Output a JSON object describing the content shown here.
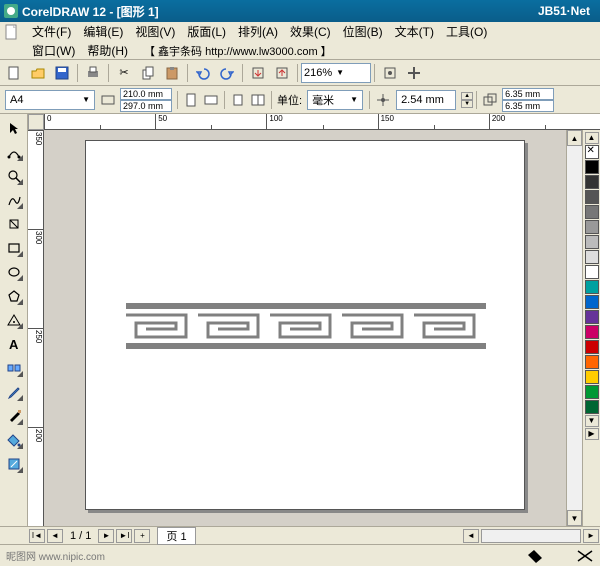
{
  "title": "CorelDRAW 12 - [图形 1]",
  "brand": "JB51·Net",
  "menus": {
    "file": "文件(F)",
    "edit": "编辑(E)",
    "view": "视图(V)",
    "layout": "版面(L)",
    "arrange": "排列(A)",
    "effects": "效果(C)",
    "bitmaps": "位图(B)",
    "text": "文本(T)",
    "tools": "工具(O)",
    "window": "窗口(W)",
    "help": "帮助(H)"
  },
  "menu_extra": "【 鑫宇条码 http://www.lw3000.com 】",
  "zoom": "216%",
  "propbar": {
    "paper": "A4",
    "width": "210.0 mm",
    "height": "297.0 mm",
    "units_label": "单位:",
    "units_value": "毫米",
    "nudge": "2.54 mm",
    "dup_x": "6.35 mm",
    "dup_y": "6.35 mm"
  },
  "ruler_h": [
    "0",
    "50",
    "100",
    "150",
    "200"
  ],
  "ruler_v": [
    "350",
    "300",
    "250",
    "200"
  ],
  "palette_colors": [
    "#000000",
    "#333333",
    "#555555",
    "#777777",
    "#999999",
    "#bbbbbb",
    "#dddddd",
    "#ffffff",
    "#00a0a0",
    "#0066cc",
    "#663399",
    "#cc0066",
    "#cc0000",
    "#ff6600",
    "#ffcc00",
    "#009933",
    "#006633"
  ],
  "pagenav": {
    "count": "1 / 1",
    "tab": "页 1"
  },
  "status_watermark": "昵图网 www.nipic.com"
}
